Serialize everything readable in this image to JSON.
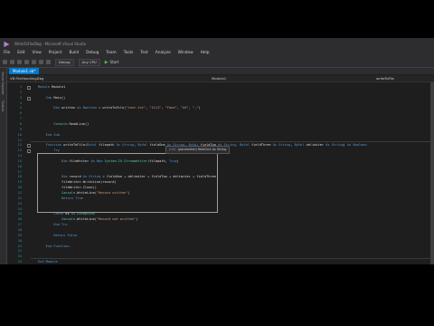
{
  "window": {
    "title": "WriteToFileDbg - Microsoft Visual Studio"
  },
  "menu": [
    "File",
    "Edit",
    "View",
    "Project",
    "Build",
    "Debug",
    "Team",
    "Tools",
    "Test",
    "Analyze",
    "Window",
    "Help"
  ],
  "toolbar": {
    "configuration": "Debug",
    "platform": "Any CPU",
    "start_label": "Start"
  },
  "side_panels": [
    "Server Explorer",
    "Toolbox"
  ],
  "document_tab": {
    "label": "Module1.vb*"
  },
  "nav": {
    "project": "VB FileHandlingDbg",
    "scope": "Module1",
    "member": "writeToFile"
  },
  "code": [
    {
      "n": "1",
      "t": [
        [
          "kw",
          "Module "
        ],
        [
          "",
          "Module1"
        ]
      ]
    },
    {
      "n": "2",
      "t": []
    },
    {
      "n": "3",
      "t": [
        [
          "",
          "    "
        ],
        [
          "kw",
          "Sub "
        ],
        [
          "",
          "Main()"
        ]
      ]
    },
    {
      "n": "4",
      "t": []
    },
    {
      "n": "5",
      "t": [
        [
          "",
          "        "
        ],
        [
          "kw",
          "Dim "
        ],
        [
          "",
          "written "
        ],
        [
          "kw",
          "As Boolean "
        ],
        [
          "",
          "= writeToFile("
        ],
        [
          "str",
          "\"test.txt\""
        ],
        [
          "",
          ", "
        ],
        [
          "str",
          "\"1111\""
        ],
        [
          "",
          ", "
        ],
        [
          "str",
          "\"Fake\""
        ],
        [
          "",
          ", "
        ],
        [
          "str",
          "\"XX\""
        ],
        [
          "",
          ", "
        ],
        [
          "str",
          "\",\""
        ],
        [
          "",
          ")"
        ]
      ]
    },
    {
      "n": "6",
      "t": []
    },
    {
      "n": "7",
      "t": []
    },
    {
      "n": "8",
      "t": [
        [
          "",
          "        "
        ],
        [
          "ty",
          "Console"
        ],
        [
          "",
          ".ReadLine()"
        ]
      ]
    },
    {
      "n": "9",
      "t": []
    },
    {
      "n": "10",
      "t": [
        [
          "",
          "    "
        ],
        [
          "kw",
          "End Sub"
        ]
      ]
    },
    {
      "n": "11",
      "t": []
    },
    {
      "n": "12",
      "t": [
        [
          "kw",
          "    Function "
        ],
        [
          "",
          "writeToFile("
        ],
        [
          "kw",
          "ByVal "
        ],
        [
          "",
          "filepath "
        ],
        [
          "kw",
          "As String"
        ],
        [
          "",
          ", "
        ],
        [
          "kw",
          "ByVal "
        ],
        [
          "",
          "fieldOne "
        ],
        [
          "kw",
          "As String"
        ],
        [
          "",
          ", "
        ],
        [
          "kw",
          "ByVal "
        ],
        [
          "",
          "fieldTwo "
        ],
        [
          "kw",
          "As String"
        ],
        [
          "",
          ", "
        ],
        [
          "kw",
          "ByVal "
        ],
        [
          "",
          "fieldThree "
        ],
        [
          "kw",
          "As String"
        ],
        [
          "",
          ", "
        ],
        [
          "kw",
          "ByVal "
        ],
        [
          "",
          "delimiter "
        ],
        [
          "kw",
          "As String"
        ],
        [
          "",
          ") "
        ],
        [
          "kw",
          "As Boolean"
        ]
      ]
    },
    {
      "n": "13",
      "t": [
        [
          "",
          "        "
        ],
        [
          "kw",
          "Try"
        ]
      ]
    },
    {
      "n": "14",
      "t": []
    },
    {
      "n": "15",
      "t": [
        [
          "",
          "            "
        ],
        [
          "kw",
          "Dim "
        ],
        [
          "",
          "fileWriter "
        ],
        [
          "kw",
          "As New "
        ],
        [
          "ty",
          "System.IO.StreamWriter"
        ],
        [
          "",
          "(filepath, "
        ],
        [
          "kw",
          "True"
        ],
        [
          "",
          ")"
        ]
      ]
    },
    {
      "n": "16",
      "t": []
    },
    {
      "n": "17",
      "t": []
    },
    {
      "n": "18",
      "t": [
        [
          "",
          "            "
        ],
        [
          "kw",
          "Dim "
        ],
        [
          "",
          "record "
        ],
        [
          "kw",
          "As String "
        ],
        [
          "",
          "= fieldOne + delimiter + fieldTwo + delimiter + fieldThree"
        ]
      ]
    },
    {
      "n": "19",
      "t": [
        [
          "",
          "            fileWriter.WriteLine(record)"
        ]
      ]
    },
    {
      "n": "20",
      "t": [
        [
          "",
          "            fileWriter.Close()"
        ]
      ]
    },
    {
      "n": "21",
      "t": [
        [
          "",
          "            "
        ],
        [
          "ty",
          "Console"
        ],
        [
          "",
          ".WriteLine("
        ],
        [
          "str",
          "\"Record written\""
        ],
        [
          "",
          ")"
        ]
      ]
    },
    {
      "n": "22",
      "t": [
        [
          "",
          "            "
        ],
        [
          "kw",
          "Return True"
        ]
      ]
    },
    {
      "n": "23",
      "t": []
    },
    {
      "n": "24",
      "t": []
    },
    {
      "n": "25",
      "t": [
        [
          "",
          "        "
        ],
        [
          "kw",
          "Catch "
        ],
        [
          "",
          "ex "
        ],
        [
          "kw",
          "As "
        ],
        [
          "ty",
          "Exception"
        ]
      ]
    },
    {
      "n": "26",
      "t": [
        [
          "",
          "            "
        ],
        [
          "ty",
          "Console"
        ],
        [
          "",
          ".WriteLine("
        ],
        [
          "str",
          "\"Record not written\""
        ],
        [
          "",
          ")"
        ]
      ]
    },
    {
      "n": "27",
      "t": [
        [
          "",
          "        "
        ],
        [
          "kw",
          "End Try"
        ]
      ]
    },
    {
      "n": "28",
      "t": []
    },
    {
      "n": "29",
      "t": [
        [
          "",
          "        "
        ],
        [
          "kw",
          "Return False"
        ]
      ]
    },
    {
      "n": "30",
      "t": []
    },
    {
      "n": "31",
      "t": [
        [
          "",
          "    "
        ],
        [
          "kw",
          "End Function"
        ]
      ]
    },
    {
      "n": "32",
      "t": []
    },
    {
      "n": "33",
      "t": []
    },
    {
      "n": "34",
      "t": [
        [
          "kw",
          "End Module"
        ]
      ]
    }
  ],
  "tooltip": {
    "tag": "(ref)",
    "text": "(parameter) fieldOne As String"
  },
  "colors": {
    "accent": "#007acc",
    "keyword": "#569cd6",
    "string": "#d69d85",
    "type": "#4ec9b0",
    "line_number": "#2b91af"
  }
}
